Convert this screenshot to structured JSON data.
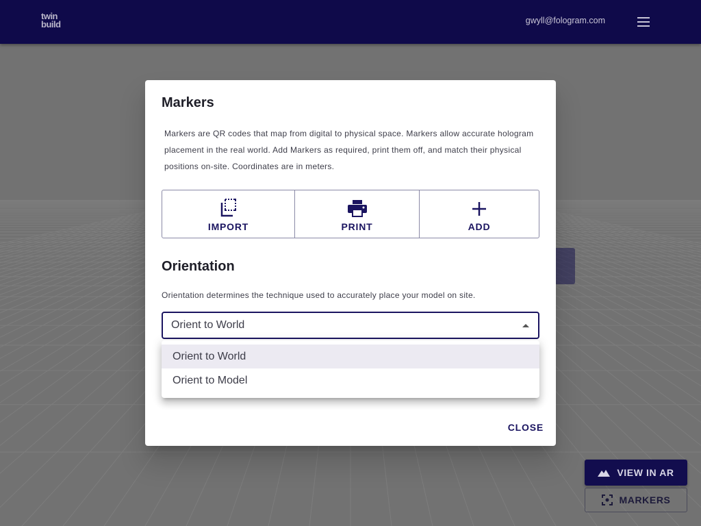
{
  "header": {
    "logo_line1": "twin",
    "logo_line2": "build",
    "user_email": "gwyll@fologram.com",
    "menu_icon": "hamburger-icon"
  },
  "dialog": {
    "markers_title": "Markers",
    "markers_description": "Markers are QR codes that map from digital to physical space. Markers allow accurate hologram placement in the real world. Add Markers as required, print them off, and match their physical positions on-site. Coordinates are in meters.",
    "buttons": [
      {
        "label": "IMPORT",
        "icon": "import-icon"
      },
      {
        "label": "PRINT",
        "icon": "printer-icon"
      },
      {
        "label": "ADD",
        "icon": "plus-icon"
      }
    ],
    "orientation_title": "Orientation",
    "orientation_description": "Orientation determines the technique used to accurately place your model on site.",
    "orientation_select": {
      "value": "Orient to World",
      "options": [
        "Orient to World",
        "Orient to Model"
      ]
    },
    "close_label": "CLOSE"
  },
  "floating": {
    "view_ar_label": "VIEW IN AR",
    "markers_label": "MARKERS"
  },
  "colors": {
    "header_bg": "#0f0a4a",
    "accent": "#1a1460",
    "scrim_bg": "#727272"
  }
}
